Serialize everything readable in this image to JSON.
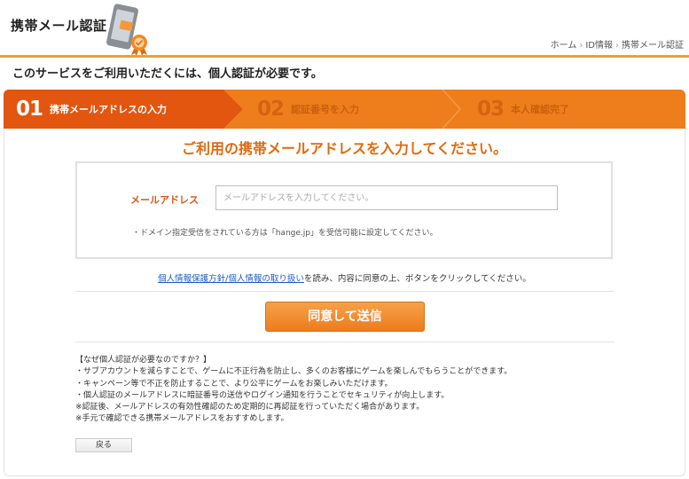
{
  "header": {
    "title": "携帯メール認証",
    "breadcrumb": [
      "ホーム",
      "ID情報",
      "携帯メール認証"
    ]
  },
  "intro": "このサービスをご利用いただくには、個人認証が必要です。",
  "steps": [
    {
      "num": "01",
      "label": "携帯メールアドレスの入力",
      "active": true
    },
    {
      "num": "02",
      "label": "認証番号を入力",
      "active": false
    },
    {
      "num": "03",
      "label": "本人確認完了",
      "active": false
    }
  ],
  "main": {
    "heading": "ご利用の携帯メールアドレスを入力してください。",
    "email_label": "メールアドレス",
    "email_placeholder": "メールアドレスを入力してください。",
    "email_value": "",
    "note": "・ドメイン指定受信をされている方は「hange.jp」を受信可能に設定してください。",
    "agree_link": "個人情報保護方針/個人情報の取り扱い",
    "agree_rest": "を読み、内容に同意の上、ボタンをクリックしてください。",
    "submit_label": "同意して送信"
  },
  "faq": [
    "【なぜ個人認証が必要なのですか？】",
    "・サブアカウントを減らすことで、ゲームに不正行為を防止し、多くのお客様にゲームを楽しんでもらうことができます。",
    "・キャンペーン等で不正を防止することで、より公平にゲームをお楽しみいただけます。",
    "・個人認証のメールアドレスに暗証番号の送信やログイン通知を行うことでセキュリティが向上します。",
    "※認証後、メールアドレスの有効性確認のため定期的に再認証を行っていただく場合があります。",
    "※手元で確認できる携帯メールアドレスをおすすめします。"
  ],
  "back_label": "戻る",
  "colors": {
    "accent": "#ee7e1b",
    "accent_dark": "#d9561a",
    "link": "#1a5cc8"
  }
}
